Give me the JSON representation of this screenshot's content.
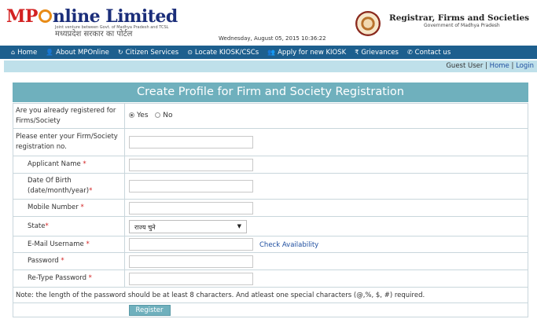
{
  "header": {
    "logo_mp": "MP",
    "logo_rest": "nline Limited",
    "logo_tagline": "Joint venture between Govt. of Madhya Pradesh and TCSL",
    "logo_hindi": "मध्यप्रदेश सरकार का पोर्टल",
    "datetime": "Wednesday, August 05, 2015 10:36:22",
    "registrar_title": "Registrar, Firms and Societies",
    "registrar_sub": "Government of Madhya Pradesh"
  },
  "nav": {
    "items": [
      {
        "icon": "home-icon",
        "glyph": "⌂",
        "label": "Home"
      },
      {
        "icon": "user-icon",
        "glyph": "👤",
        "label": "About MPOnline"
      },
      {
        "icon": "refresh-icon",
        "glyph": "↻",
        "label": "Citizen Services"
      },
      {
        "icon": "location-icon",
        "glyph": "⊙",
        "label": "Locate KIOSK/CSCs"
      },
      {
        "icon": "users-icon",
        "glyph": "👥",
        "label": "Apply for new KIOSK"
      },
      {
        "icon": "rupee-icon",
        "glyph": "₹",
        "label": "Grievances"
      },
      {
        "icon": "phone-icon",
        "glyph": "✆",
        "label": "Contact us"
      }
    ],
    "colors": {
      "bar": "#1d5f8e"
    }
  },
  "subbar": {
    "guest": "Guest User",
    "sep": "|",
    "home": "Home",
    "login": "Login"
  },
  "form": {
    "title": "Create Profile for Firm and Society Registration",
    "already_registered_label": "Are you already registered for Firms/Society",
    "radio_yes": "Yes",
    "radio_no": "No",
    "selected": "Yes",
    "registration_no_label": "Please enter your Firm/Society registration no.",
    "applicant_name_label": "Applicant Name",
    "dob_label": "Date Of Birth (date/month/year)",
    "mobile_label": "Mobile Number",
    "state_label": "State",
    "state_value": "राज्य चुने",
    "email_label": "E-Mail Username",
    "check_availability": "Check Availability",
    "password_label": "Password",
    "retype_password_label": "Re-Type Password",
    "required_mark": "*",
    "note": "Note: the length of the password should be at least 8 characters. And atleast one special characters (@,%, $, #) required.",
    "register_button": "Register",
    "colors": {
      "title_bg": "#6fb0bd",
      "required": "#d32222",
      "link": "#1f4fa0"
    }
  }
}
